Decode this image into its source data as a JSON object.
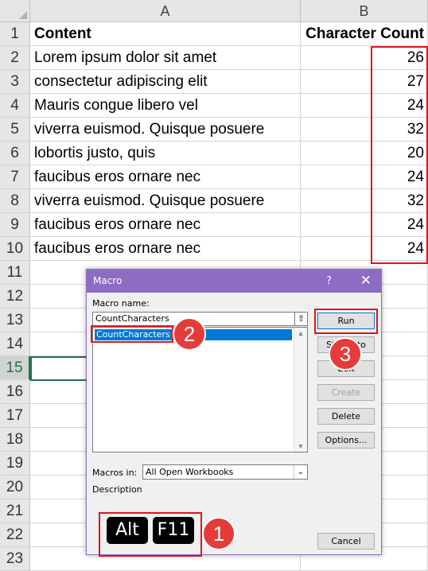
{
  "sheet": {
    "columns": [
      "A",
      "B"
    ],
    "rows": [
      {
        "num": "1",
        "a": "Content",
        "b": "Character Count"
      },
      {
        "num": "2",
        "a": "Lorem ipsum dolor sit amet",
        "b": "26"
      },
      {
        "num": "3",
        "a": "consectetur adipiscing elit",
        "b": "27"
      },
      {
        "num": "4",
        "a": "Mauris congue libero vel",
        "b": "24"
      },
      {
        "num": "5",
        "a": "viverra euismod. Quisque posuere",
        "b": "32"
      },
      {
        "num": "6",
        "a": "lobortis justo, quis",
        "b": "20"
      },
      {
        "num": "7",
        "a": "faucibus eros ornare nec",
        "b": "24"
      },
      {
        "num": "8",
        "a": "viverra euismod. Quisque posuere",
        "b": "32"
      },
      {
        "num": "9",
        "a": "faucibus eros ornare nec",
        "b": "24"
      },
      {
        "num": "10",
        "a": "faucibus eros ornare nec",
        "b": "24"
      },
      {
        "num": "11",
        "a": "",
        "b": ""
      },
      {
        "num": "12",
        "a": "",
        "b": ""
      },
      {
        "num": "13",
        "a": "",
        "b": ""
      },
      {
        "num": "14",
        "a": "",
        "b": ""
      },
      {
        "num": "15",
        "a": "",
        "b": ""
      },
      {
        "num": "16",
        "a": "",
        "b": ""
      },
      {
        "num": "17",
        "a": "",
        "b": ""
      },
      {
        "num": "18",
        "a": "",
        "b": ""
      },
      {
        "num": "19",
        "a": "",
        "b": ""
      },
      {
        "num": "20",
        "a": "",
        "b": ""
      },
      {
        "num": "21",
        "a": "",
        "b": ""
      },
      {
        "num": "22",
        "a": "",
        "b": ""
      },
      {
        "num": "23",
        "a": "",
        "b": ""
      }
    ],
    "selected_row": "15"
  },
  "dialog": {
    "title": "Macro",
    "help": "?",
    "close": "✕",
    "macro_name_label": "Macro name:",
    "macro_name_value": "CountCharacters",
    "macros": [
      "CountCharacters"
    ],
    "macros_in_label": "Macros in:",
    "macros_in_value": "All Open Workbooks",
    "description_label": "Description",
    "buttons": {
      "run": "Run",
      "step_into": "Step Into",
      "edit": "Edit",
      "create": "Create",
      "delete": "Delete",
      "options": "Options...",
      "cancel": "Cancel"
    }
  },
  "keys": [
    "Alt",
    "F11"
  ],
  "steps": [
    "1",
    "2",
    "3"
  ],
  "colors": {
    "highlight": "#e0151c",
    "badge": "#e63b3b",
    "dialog_title": "#8e6cc4",
    "selection": "#217346"
  }
}
